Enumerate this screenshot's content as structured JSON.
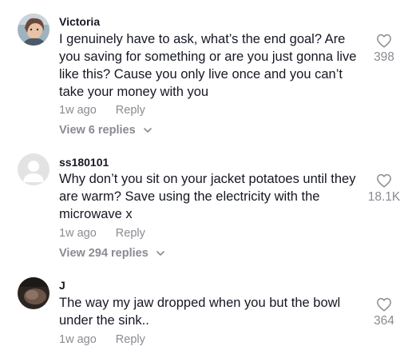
{
  "comments": [
    {
      "username": "Victoria",
      "text": "I genuinely have to ask, what’s the end goal? Are you saving for something or are you just gonna live like this? Cause you only live once and you can’t take your money with you",
      "time": "1w ago",
      "reply_label": "Reply",
      "view_replies": "View 6 replies",
      "likes": "398",
      "avatar": "photo"
    },
    {
      "username": "ss180101",
      "text": "Why don’t you sit on your jacket potatoes until they are warm? Save using the electricity with the microwave x",
      "time": "1w ago",
      "reply_label": "Reply",
      "view_replies": "View 294 replies",
      "likes": "18.1K",
      "avatar": "default-person"
    },
    {
      "username": "J",
      "text": "The way my jaw dropped when you but the bowl under the sink..",
      "time": "1w ago",
      "reply_label": "Reply",
      "likes": "364",
      "avatar": "photo-dark"
    }
  ],
  "icons": {
    "like": "heart-icon",
    "expand": "chevron-down-icon"
  },
  "colors": {
    "text": "#161823",
    "secondary": "#8a8b91"
  }
}
